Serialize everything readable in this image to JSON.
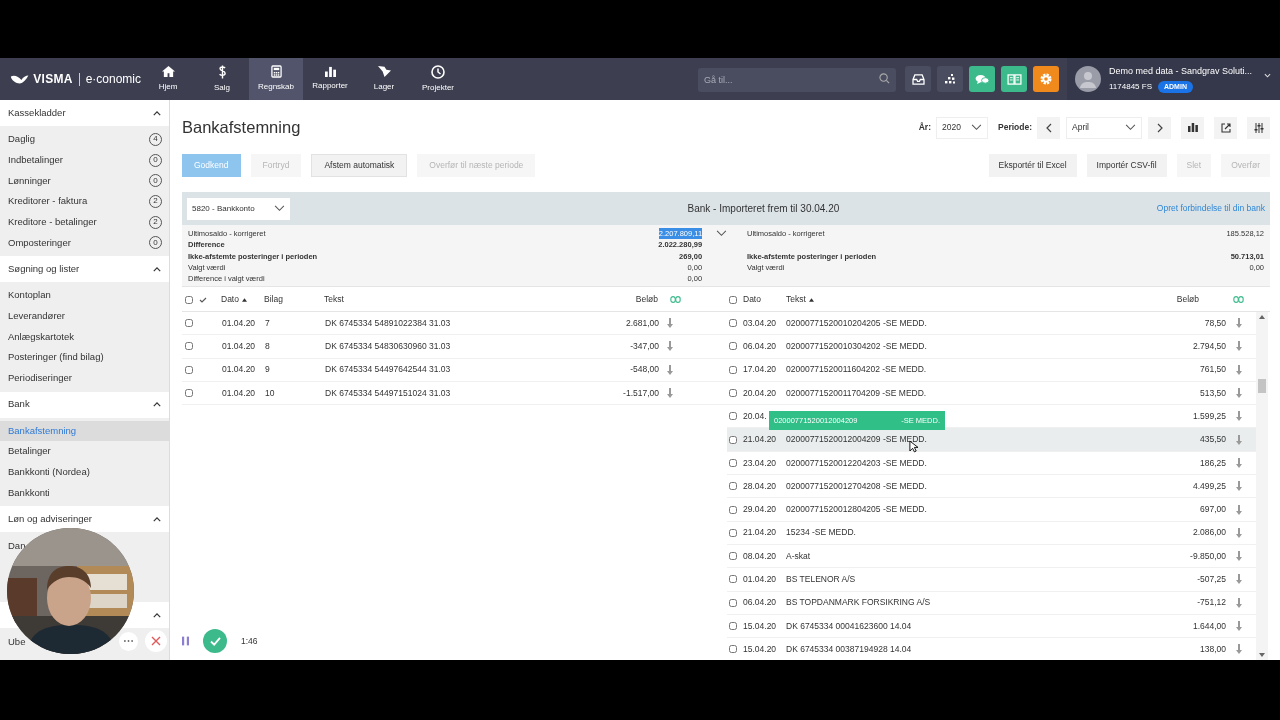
{
  "nav": {
    "brand": "VISMA",
    "product": "e·conomic",
    "items": [
      {
        "label": "Hjem",
        "selected": false
      },
      {
        "label": "Salg",
        "selected": false
      },
      {
        "label": "Regnskab",
        "selected": true
      },
      {
        "label": "Rapporter",
        "selected": false
      },
      {
        "label": "Lager",
        "selected": false
      },
      {
        "label": "Projekter",
        "selected": false
      }
    ],
    "search": {
      "placeholder": "Gå til..."
    },
    "account": {
      "name": "Demo med data - Sandgrav Soluti...",
      "id": "1174845 FS",
      "badge": "ADMIN"
    }
  },
  "sidebar": {
    "sections": [
      {
        "title": "Kassekladder",
        "expanded": true,
        "items": [
          {
            "label": "Daglig",
            "count": "4",
            "selected": false
          },
          {
            "label": "Indbetalinger",
            "count": "0",
            "selected": false
          },
          {
            "label": "Lønninger",
            "count": "0",
            "selected": false
          },
          {
            "label": "Kreditorer - faktura",
            "count": "2",
            "selected": false
          },
          {
            "label": "Kreditore - betalinger",
            "count": "2",
            "selected": false
          },
          {
            "label": "Omposteringer",
            "count": "0",
            "selected": false
          }
        ]
      },
      {
        "title": "Søgning og lister",
        "expanded": true,
        "items": [
          {
            "label": "Kontoplan",
            "selected": false
          },
          {
            "label": "Leverandører",
            "selected": false
          },
          {
            "label": "Anlægskartotek",
            "selected": false
          },
          {
            "label": "Posteringer (find bilag)",
            "selected": false
          },
          {
            "label": "Periodiseringer",
            "selected": false
          }
        ]
      },
      {
        "title": "Bank",
        "expanded": true,
        "items": [
          {
            "label": "Bankafstemning",
            "selected": true
          },
          {
            "label": "Betalinger",
            "selected": false
          },
          {
            "label": "Bankkonti (Nordea)",
            "selected": false
          },
          {
            "label": "Bankkonti",
            "selected": false
          }
        ]
      },
      {
        "title": "Løn og adviseringer",
        "expanded": true,
        "items": [
          {
            "label": "Dan",
            "selected": false
          }
        ]
      },
      {
        "expanded": true,
        "items": [
          {
            "label": "Ube",
            "selected": false
          }
        ]
      }
    ]
  },
  "page": {
    "title": "Bankafstemning",
    "year_label": "År:",
    "year": "2020",
    "period_label": "Periode:",
    "period": "April",
    "actions_left": [
      {
        "label": "Godkend",
        "kind": "primary",
        "disabled": true
      },
      {
        "label": "Fortryd",
        "kind": "default",
        "disabled": true
      },
      {
        "label": "Afstem automatisk",
        "kind": "default",
        "disabled": false
      },
      {
        "label": "Overfør til næste periode",
        "kind": "default",
        "disabled": true
      }
    ],
    "actions_right": [
      {
        "label": "Eksportér til Excel",
        "disabled": false
      },
      {
        "label": "Importér CSV-fil",
        "disabled": false
      },
      {
        "label": "Slet",
        "disabled": true
      },
      {
        "label": "Overfør",
        "disabled": true
      }
    ],
    "account_select": "5820 - Bankkonto",
    "bank_heading": "Bank - Importeret frem til 30.04.20",
    "bank_link": "Opret forbindelse til din bank",
    "summary_left": [
      {
        "label": "Ultimosaldo - korrigeret",
        "value": "2.207.809,11",
        "bold": false,
        "highlighted": true
      },
      {
        "label": "Difference",
        "value": "2.022.280,99",
        "bold": true,
        "highlighted": false
      },
      {
        "label": "Ikke-afstemte posteringer i perioden",
        "value": "269,00",
        "bold": true,
        "highlighted": false
      },
      {
        "label": "Valgt værdi",
        "value": "0,00",
        "bold": false,
        "highlighted": false
      },
      {
        "label": "Difference i valgt værdi",
        "value": "0,00",
        "bold": false,
        "highlighted": false
      }
    ],
    "summary_right": [
      {
        "label": "Ultimosaldo - korrigeret",
        "value": "185.528,12",
        "bold": false
      },
      {
        "label": "Ikke-afstemte posteringer i perioden",
        "value": "50.713,01",
        "bold": true
      },
      {
        "label": "Valgt værdi",
        "value": "0,00",
        "bold": false
      }
    ],
    "ledger": {
      "select_all": false,
      "columns": [
        "Dato",
        "Bilag",
        "Tekst",
        "Beløb"
      ],
      "rows": [
        {
          "date": "01.04.20",
          "voucher": "7",
          "text": "DK 6745334 54891022384 31.03",
          "amount": "2.681,00",
          "checked": false
        },
        {
          "date": "01.04.20",
          "voucher": "8",
          "text": "DK 6745334 54830630960 31.03",
          "amount": "-347,00",
          "checked": false
        },
        {
          "date": "01.04.20",
          "voucher": "9",
          "text": "DK 6745334 54497642544 31.03",
          "amount": "-548,00",
          "checked": false
        },
        {
          "date": "01.04.20",
          "voucher": "10",
          "text": "DK 6745334 54497151024 31.03",
          "amount": "-1.517,00",
          "checked": false
        }
      ]
    },
    "bank": {
      "select_all": false,
      "columns": [
        "Dato",
        "Tekst",
        "Beløb"
      ],
      "rows": [
        {
          "date": "03.04.20",
          "text": "02000771520010204205 -SE MEDD.",
          "amount": "78,50",
          "checked": false,
          "hovered": false
        },
        {
          "date": "06.04.20",
          "text": "02000771520010304202 -SE MEDD.",
          "amount": "2.794,50",
          "checked": false,
          "hovered": false
        },
        {
          "date": "17.04.20",
          "text": "02000771520011604202 -SE MEDD.",
          "amount": "761,50",
          "checked": false,
          "hovered": false
        },
        {
          "date": "20.04.20",
          "text": "02000771520011704209 -SE MEDD.",
          "amount": "513,50",
          "checked": false,
          "hovered": false
        },
        {
          "date": "20.04.",
          "amount": "1.599,25",
          "checked": false,
          "hovered": false
        },
        {
          "date": "21.04.20",
          "text": "02000771520012004209 -SE MEDD.",
          "amount": "435,50",
          "checked": false,
          "hovered": true
        },
        {
          "date": "23.04.20",
          "text": "02000771520012204203 -SE MEDD.",
          "amount": "186,25",
          "checked": false,
          "hovered": false
        },
        {
          "date": "28.04.20",
          "text": "02000771520012704208 -SE MEDD.",
          "amount": "4.499,25",
          "checked": false,
          "hovered": false
        },
        {
          "date": "29.04.20",
          "text": "02000771520012804205 -SE MEDD.",
          "amount": "697,00",
          "checked": false,
          "hovered": false
        },
        {
          "date": "21.04.20",
          "text": "15234 -SE MEDD.",
          "amount": "2.086,00",
          "checked": false,
          "hovered": false
        },
        {
          "date": "08.04.20",
          "text": "A-skat",
          "amount": "-9.850,00",
          "checked": false,
          "hovered": false
        },
        {
          "date": "01.04.20",
          "text": "BS TELENOR A/S",
          "amount": "-507,25",
          "checked": false,
          "hovered": false
        },
        {
          "date": "06.04.20",
          "text": "BS TOPDANMARK FORSIKRING A/S",
          "amount": "-751,12",
          "checked": false,
          "hovered": false
        },
        {
          "date": "15.04.20",
          "text": "DK 6745334 00041623600 14.04",
          "amount": "1.644,00",
          "checked": false,
          "hovered": false
        },
        {
          "date": "15.04.20",
          "text": "DK 6745334 00387194928 14.04",
          "amount": "138,00",
          "checked": false,
          "hovered": false
        }
      ]
    },
    "drag_ghost": {
      "text": "02000771520012004209",
      "suffix": "-SE MEDD."
    }
  },
  "recorder": {
    "time": "1:46"
  }
}
